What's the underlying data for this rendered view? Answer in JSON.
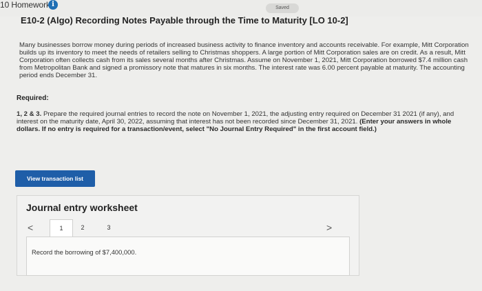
{
  "header": {
    "homework_label": "10 Homework",
    "saved_label": "Saved"
  },
  "problem": {
    "title": "E10-2 (Algo) Recording Notes Payable through the Time to Maturity [LO 10-2]",
    "paragraph": "Many businesses borrow money during periods of increased business activity to finance inventory and accounts receivable. For example, Mitt Corporation builds up its inventory to meet the needs of retailers selling to Christmas shoppers. A large portion of Mitt Corporation sales are on credit. As a result, Mitt Corporation often collects cash from its sales several months after Christmas. Assume on November 1, 2021, Mitt Corporation borrowed $7.4 million cash from Metropolitan Bank and signed a promissory note that matures in six months. The interest rate was 6.00 percent payable at maturity. The accounting period ends December 31.",
    "required_label": "Required:",
    "question_number": "1, 2 & 3.",
    "question_text": "Prepare the required journal entries to record the note on November 1, 2021, the adjusting entry required on December 31 2021 (if any), and interest on the maturity date, April 30, 2022, assuming that interest has not been recorded since December 31, 2021.",
    "question_note": "(Enter your answers in whole dollars. If no entry is required for a transaction/event, select \"No Journal Entry Required\" in the first account field.)"
  },
  "buttons": {
    "view_transactions": "View transaction list"
  },
  "worksheet": {
    "title": "Journal entry worksheet",
    "prev": "<",
    "next": ">",
    "tabs": [
      "1",
      "2",
      "3"
    ],
    "active_tab": "1",
    "instruction": "Record the borrowing of $7,400,000."
  }
}
